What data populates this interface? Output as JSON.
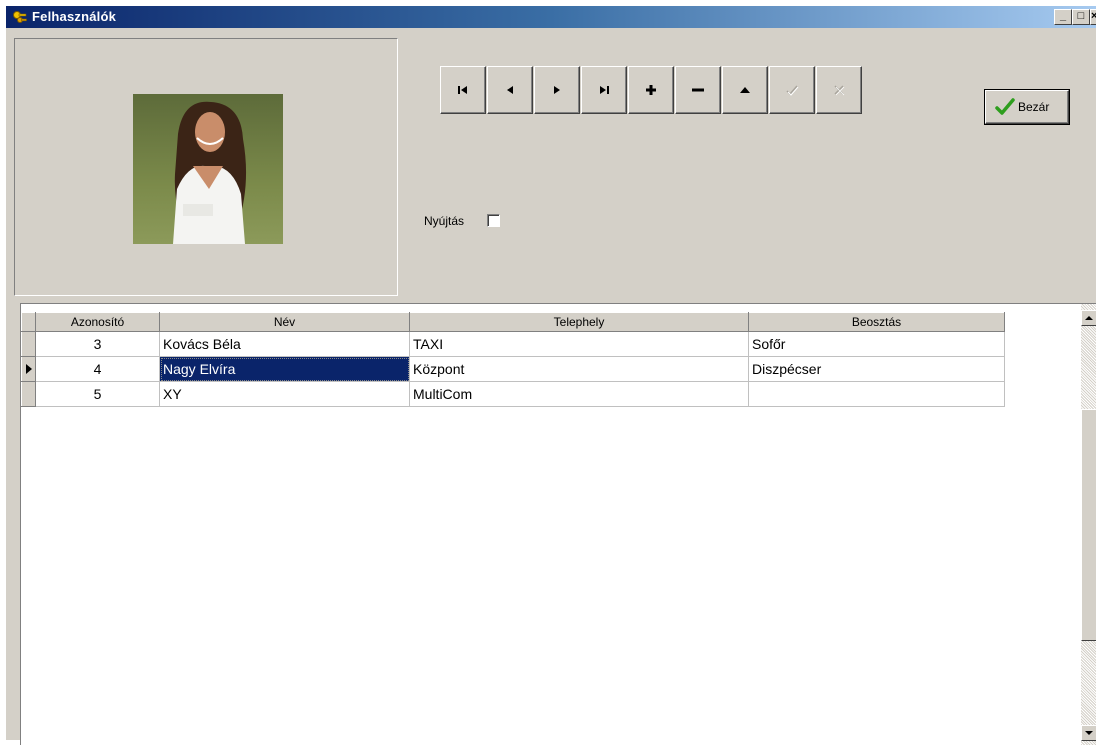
{
  "window": {
    "title": "Felhasználók",
    "controls": {
      "minimize": "_",
      "maximize": "□",
      "close": "×"
    }
  },
  "photo": {
    "alt": "user photo"
  },
  "navigator": {
    "buttons": [
      {
        "name": "first",
        "icon": "first-record-icon",
        "enabled": true
      },
      {
        "name": "prior",
        "icon": "prior-record-icon",
        "enabled": true
      },
      {
        "name": "next",
        "icon": "next-record-icon",
        "enabled": true
      },
      {
        "name": "last",
        "icon": "last-record-icon",
        "enabled": true
      },
      {
        "name": "insert",
        "icon": "plus-icon",
        "enabled": true
      },
      {
        "name": "delete",
        "icon": "minus-icon",
        "enabled": true
      },
      {
        "name": "edit",
        "icon": "edit-up-icon",
        "enabled": true
      },
      {
        "name": "post",
        "icon": "check-icon",
        "enabled": false
      },
      {
        "name": "cancel",
        "icon": "cancel-x-icon",
        "enabled": false
      }
    ]
  },
  "close_button": {
    "label": "Bezár",
    "icon": "green-check-icon"
  },
  "stretch": {
    "label": "Nyújtás",
    "checked": false
  },
  "grid": {
    "columns": [
      "Azonosító",
      "Név",
      "Telephely",
      "Beosztás"
    ],
    "rows": [
      {
        "id": "3",
        "name": "Kovács Béla",
        "site": "TAXI",
        "role": "Sofőr",
        "current": false
      },
      {
        "id": "4",
        "name": "Nagy Elvíra",
        "site": "Központ",
        "role": "Diszpécser",
        "current": true
      },
      {
        "id": "5",
        "name": "XY",
        "site": "MultiCom",
        "role": "",
        "current": false
      }
    ]
  },
  "colors": {
    "titlebar": "#0a246a",
    "selection": "#0a246a",
    "face": "#d4d0c8",
    "check_green": "#2e9e1e"
  }
}
